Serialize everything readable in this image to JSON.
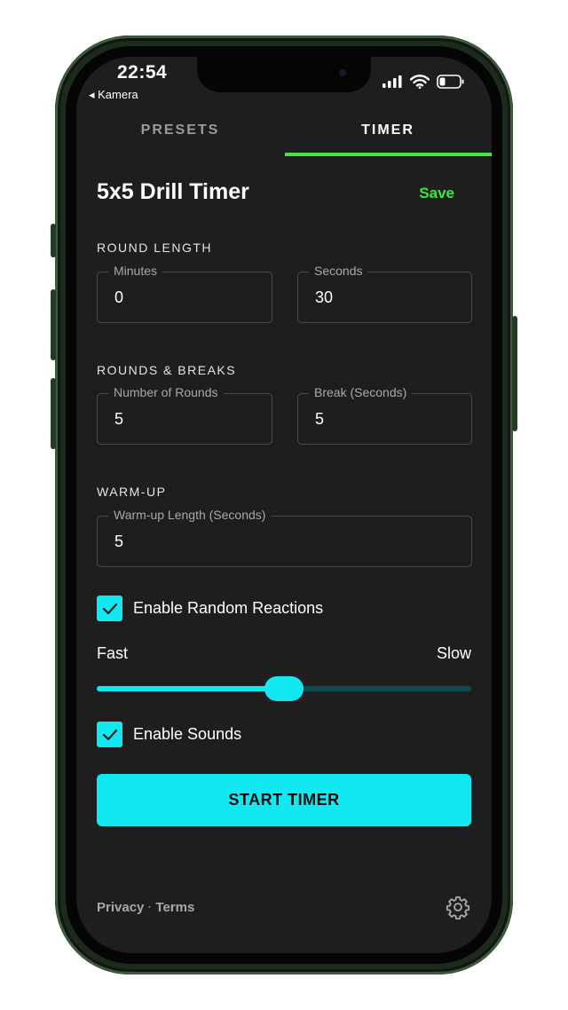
{
  "status_bar": {
    "time": "22:54",
    "back_label": "◂ Kamera"
  },
  "tabs": [
    {
      "label": "PRESETS",
      "active": false
    },
    {
      "label": "TIMER",
      "active": true
    }
  ],
  "header": {
    "title": "5x5 Drill Timer",
    "save_label": "Save"
  },
  "round_length": {
    "section_label": "ROUND LENGTH",
    "minutes": {
      "label": "Minutes",
      "value": "0"
    },
    "seconds": {
      "label": "Seconds",
      "value": "30"
    }
  },
  "rounds_breaks": {
    "section_label": "ROUNDS & BREAKS",
    "rounds": {
      "label": "Number of Rounds",
      "value": "5"
    },
    "break": {
      "label": "Break (Seconds)",
      "value": "5"
    }
  },
  "warmup": {
    "section_label": "WARM-UP",
    "length": {
      "label": "Warm-up Length (Seconds)",
      "value": "5"
    }
  },
  "reactions": {
    "label": "Enable Random Reactions",
    "checked": true
  },
  "speed_slider": {
    "min_label": "Fast",
    "max_label": "Slow",
    "value_fraction": 0.5
  },
  "sounds": {
    "label": "Enable Sounds",
    "checked": true
  },
  "start_label": "START TIMER",
  "footer": {
    "privacy": "Privacy",
    "separator": "·",
    "terms": "Terms"
  },
  "colors": {
    "accent": "#12e8f2",
    "tab_indicator": "#3ee63e",
    "save": "#3ee63e",
    "background": "#1e1e1e"
  },
  "icons": [
    "signal-icon",
    "wifi-icon",
    "battery-icon",
    "check-icon",
    "gear-icon"
  ]
}
